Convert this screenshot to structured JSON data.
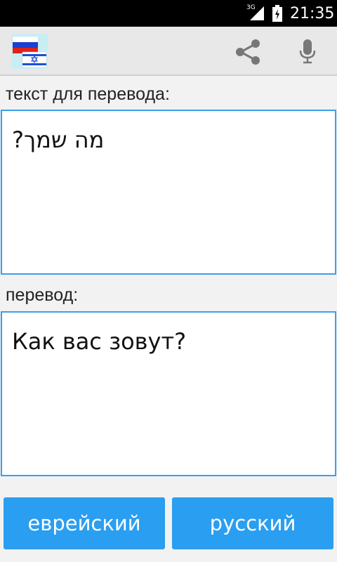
{
  "status_bar": {
    "network": "3G",
    "time": "21:35"
  },
  "action_bar": {
    "logo_icon": "russian-israeli-flags-icon",
    "share_icon": "share-icon",
    "mic_icon": "microphone-icon"
  },
  "source": {
    "label": "текст для перевода:",
    "value": "מה שמך?"
  },
  "target": {
    "label": "перевод:",
    "value": "Как вас зовут?"
  },
  "buttons": {
    "hebrew": "еврейский",
    "russian": "русский"
  },
  "colors": {
    "accent": "#2a9ef0",
    "border": "#3aa0ec"
  }
}
